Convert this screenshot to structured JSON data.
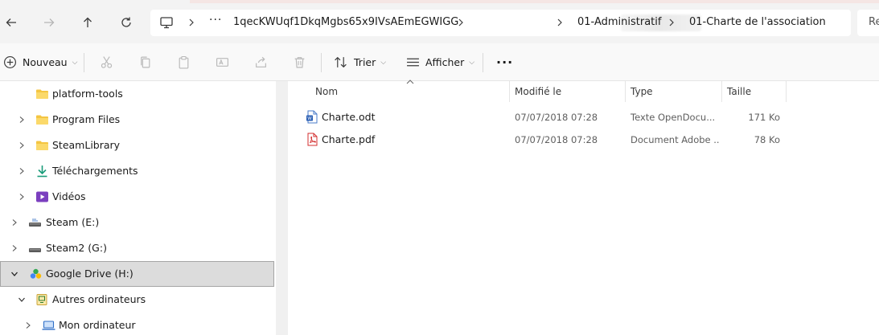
{
  "address_bar": {
    "crumbs": [
      "1qecKWUqf1DkqMgbs65x9IVsAEmEGWIGG",
      "01-Administratif",
      "01-Charte de l'association"
    ],
    "search_partial": "Re"
  },
  "command_bar": {
    "new_label": "Nouveau",
    "sort_label": "Trier",
    "view_label": "Afficher",
    "more_label": "···"
  },
  "nav_tree": [
    {
      "label": "platform-tools",
      "icon": "folder-icon",
      "expandable": false
    },
    {
      "label": "Program Files",
      "icon": "folder-icon",
      "expandable": true
    },
    {
      "label": "SteamLibrary",
      "icon": "folder-icon",
      "expandable": true
    },
    {
      "label": "Téléchargements",
      "icon": "download-icon",
      "expandable": true
    },
    {
      "label": "Vidéos",
      "icon": "video-icon",
      "expandable": true
    },
    {
      "label": "Steam (E:)",
      "icon": "drive-icon",
      "expandable": true
    },
    {
      "label": "Steam2 (G:)",
      "icon": "drive-icon",
      "expandable": true
    },
    {
      "label": "Google Drive (H:)",
      "icon": "google-drive-icon",
      "expandable": true,
      "expanded": true,
      "selected": true
    },
    {
      "label": "Autres ordinateurs",
      "icon": "other-computers-icon",
      "expandable": true,
      "expanded": true
    },
    {
      "label": "Mon ordinateur",
      "icon": "laptop-icon",
      "expandable": true
    }
  ],
  "columns": {
    "name": "Nom",
    "modified": "Modifié le",
    "type": "Type",
    "size": "Taille"
  },
  "files": [
    {
      "name": "Charte.odt",
      "modified": "07/07/2018 07:28",
      "type": "Texte OpenDocu...",
      "size": "171 Ko",
      "icon": "odt-document-icon"
    },
    {
      "name": "Charte.pdf",
      "modified": "07/07/2018 07:28",
      "type": "Document Adobe ...",
      "size": "78 Ko",
      "icon": "pdf-document-icon"
    }
  ],
  "colors": {
    "accent": "#0067c0",
    "folder": "#f4c542",
    "selected_bg": "#dcdcdc",
    "pdf_red": "#d32f2f"
  }
}
